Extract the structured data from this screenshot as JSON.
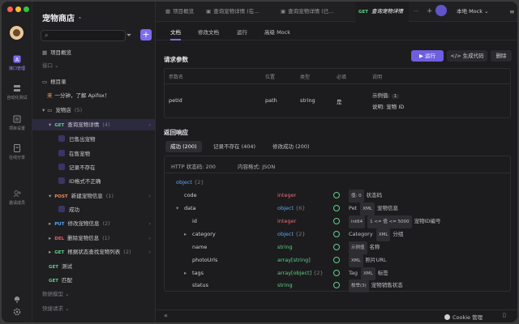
{
  "app": {
    "project_name": "宠物商店",
    "rail": [
      {
        "label": "接口管理",
        "icon": "api-icon"
      },
      {
        "label": "自动化测试",
        "icon": "test-icon"
      },
      {
        "label": "项目设置",
        "icon": "settings-icon"
      },
      {
        "label": "在线分享",
        "icon": "share-icon"
      },
      {
        "label": "邀请成员",
        "icon": "invite-icon"
      }
    ]
  },
  "sidebar": {
    "search_placeholder": "",
    "overview": "项目概览",
    "api_group": "接口",
    "root": "根目录",
    "intro": "一分钟，了解 Apifox！",
    "intro_badge": "来",
    "folder": "宠物店",
    "folder_count": "(5)",
    "items": [
      {
        "method": "GET",
        "name": "查询宠物详情",
        "count": "(4)"
      },
      {
        "case": "已售出宠物"
      },
      {
        "case": "在售宠物"
      },
      {
        "case": "记录不存在"
      },
      {
        "case": "ID格式不正确"
      },
      {
        "method": "POST",
        "name": "新建宠物信息",
        "count": "(1)"
      },
      {
        "case": "成功"
      },
      {
        "method": "PUT",
        "name": "修改宠物信息",
        "count": "(2)"
      },
      {
        "method": "DEL",
        "name": "删除宠物信息",
        "count": "(1)"
      },
      {
        "method": "GET",
        "name": "根据状态查找宠物列表",
        "count": "(2)"
      },
      {
        "method": "GET",
        "name": "测试"
      },
      {
        "method": "GET",
        "name": "匹配"
      }
    ],
    "models": "数据模型",
    "quick": "快捷请求"
  },
  "tabs": {
    "items": [
      "项目概览",
      "查询宠物详情 (在...",
      "查询宠物详情 (已..."
    ],
    "active_method": "GET",
    "active_label": "查询宠物详情",
    "more": "···",
    "env": "本地 Mock"
  },
  "subtabs": [
    "文档",
    "修改文档",
    "运行",
    "高级 Mock"
  ],
  "actions": {
    "run": "运行",
    "code": "生成代码",
    "delete": "删除"
  },
  "params": {
    "title": "请求参数",
    "headers": [
      "参数名",
      "位置",
      "类型",
      "必填",
      "说明"
    ],
    "row": {
      "name": "petId",
      "in": "path",
      "type": "string",
      "required": "是",
      "example_label": "示例值:",
      "example": "1",
      "desc_label": "说明:",
      "desc": "宠物 ID"
    }
  },
  "response": {
    "title": "返回响应",
    "tabs": [
      "成功 (200)",
      "记录不存在 (404)",
      "修改成功 (200)"
    ],
    "status": "HTTP 状态码: 200",
    "format": "内容格式: JSON",
    "root": {
      "name": "object",
      "count": "{2}"
    },
    "fields": [
      {
        "name": "code",
        "type": "integer",
        "tc": "red",
        "chips": [
          "值: 0"
        ],
        "desc": "状态码"
      },
      {
        "name": "data",
        "type": "object",
        "tcount": "{6}",
        "tc": "blue",
        "chips": [
          "Pet",
          "XML"
        ],
        "desc": "宠物信息"
      },
      {
        "name": "id",
        "type": "integer",
        "tc": "red",
        "chips": [
          "int64",
          "1 <= 值 <= 5000"
        ],
        "desc": "宠物ID编号"
      },
      {
        "name": "category",
        "type": "object",
        "tcount": "{2}",
        "tc": "blue",
        "chips": [
          "Category",
          "XML"
        ],
        "desc": "分组"
      },
      {
        "name": "name",
        "type": "string",
        "tc": "grn",
        "chips": [
          "示例值"
        ],
        "desc": "名称"
      },
      {
        "name": "photoUrls",
        "type": "array[string]",
        "tc": "grn",
        "chips": [
          "XML"
        ],
        "desc": "照片URL"
      },
      {
        "name": "tags",
        "type": "array[object]",
        "tcount": "{2}",
        "tc": "grn",
        "chips": [
          "Tag",
          "XML"
        ],
        "desc": "标签"
      },
      {
        "name": "status",
        "type": "string",
        "tc": "grn",
        "chips": [
          "枚举(3)"
        ],
        "desc": "宠物销售状态"
      }
    ]
  },
  "footer": {
    "cookie": "Cookie 管理",
    "collapse": "«"
  }
}
